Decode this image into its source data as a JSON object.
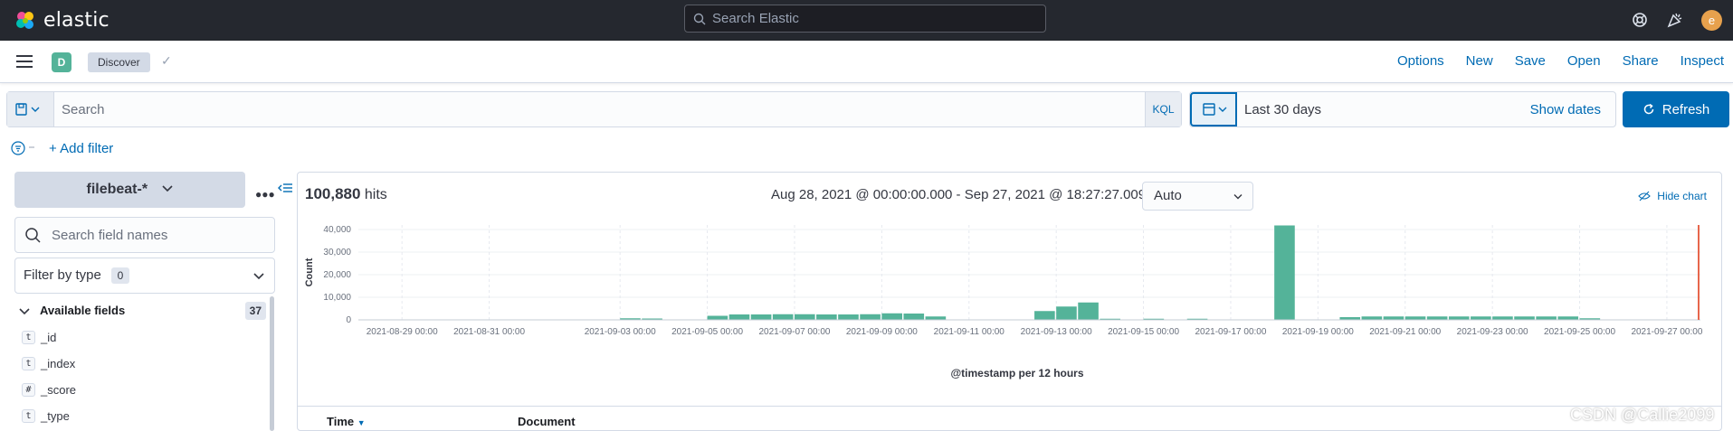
{
  "header": {
    "brand": "elastic",
    "search_placeholder": "Search Elastic",
    "avatar_initial": "e"
  },
  "appbar": {
    "space_initial": "D",
    "breadcrumb": "Discover",
    "links": [
      "Options",
      "New",
      "Save",
      "Open",
      "Share",
      "Inspect"
    ]
  },
  "query": {
    "placeholder": "Search",
    "language": "KQL",
    "time_range": "Last 30 days",
    "show_dates": "Show dates",
    "refresh": "Refresh",
    "add_filter": "+ Add filter"
  },
  "sidebar": {
    "index_pattern": "filebeat-*",
    "field_search_placeholder": "Search field names",
    "filter_by_type": "Filter by type",
    "filter_count": "0",
    "available_fields_label": "Available fields",
    "available_fields_count": "37",
    "fields": [
      {
        "type": "t",
        "name": "_id"
      },
      {
        "type": "t",
        "name": "_index"
      },
      {
        "type": "#",
        "name": "_score"
      },
      {
        "type": "t",
        "name": "_type"
      }
    ]
  },
  "main": {
    "hits_count": "100,880",
    "hits_label": "hits",
    "time_range_text": "Aug 28, 2021 @ 00:00:00.000 - Sep 27, 2021 @ 18:27:27.009",
    "interval": "Auto",
    "hide_chart": "Hide chart",
    "table_columns": [
      "Time",
      "Document"
    ]
  },
  "chart_data": {
    "type": "bar",
    "ylabel": "Count",
    "xlabel": "@timestamp per 12 hours",
    "ylim": [
      0,
      42000
    ],
    "y_ticks": [
      "0",
      "10,000",
      "20,000",
      "30,000",
      "40,000"
    ],
    "x_ticks": [
      "2021-08-29 00:00",
      "2021-08-31 00:00",
      "2021-09-03 00:00",
      "2021-09-05 00:00",
      "2021-09-07 00:00",
      "2021-09-09 00:00",
      "2021-09-11 00:00",
      "2021-09-13 00:00",
      "2021-09-15 00:00",
      "2021-09-17 00:00",
      "2021-09-19 00:00",
      "2021-09-21 00:00",
      "2021-09-23 00:00",
      "2021-09-25 00:00",
      "2021-09-27 00:00"
    ],
    "bar_color": "#54b399",
    "now_marker_color": "#e7664c",
    "series": [
      {
        "x": "2021-09-03 00:00",
        "y": 700
      },
      {
        "x": "2021-09-03 12:00",
        "y": 600
      },
      {
        "x": "2021-09-05 00:00",
        "y": 1800
      },
      {
        "x": "2021-09-05 12:00",
        "y": 2400
      },
      {
        "x": "2021-09-06 00:00",
        "y": 2400
      },
      {
        "x": "2021-09-06 12:00",
        "y": 2500
      },
      {
        "x": "2021-09-07 00:00",
        "y": 2500
      },
      {
        "x": "2021-09-07 12:00",
        "y": 2400
      },
      {
        "x": "2021-09-08 00:00",
        "y": 2400
      },
      {
        "x": "2021-09-08 12:00",
        "y": 2500
      },
      {
        "x": "2021-09-09 00:00",
        "y": 2900
      },
      {
        "x": "2021-09-09 12:00",
        "y": 2800
      },
      {
        "x": "2021-09-10 00:00",
        "y": 1500
      },
      {
        "x": "2021-09-12 12:00",
        "y": 3900
      },
      {
        "x": "2021-09-13 00:00",
        "y": 5900
      },
      {
        "x": "2021-09-13 12:00",
        "y": 7700
      },
      {
        "x": "2021-09-14 00:00",
        "y": 500
      },
      {
        "x": "2021-09-15 00:00",
        "y": 500
      },
      {
        "x": "2021-09-16 00:00",
        "y": 500
      },
      {
        "x": "2021-09-18 00:00",
        "y": 41800
      },
      {
        "x": "2021-09-19 12:00",
        "y": 1200
      },
      {
        "x": "2021-09-20 00:00",
        "y": 1500
      },
      {
        "x": "2021-09-20 12:00",
        "y": 1500
      },
      {
        "x": "2021-09-21 00:00",
        "y": 1500
      },
      {
        "x": "2021-09-21 12:00",
        "y": 1500
      },
      {
        "x": "2021-09-22 00:00",
        "y": 1500
      },
      {
        "x": "2021-09-22 12:00",
        "y": 1500
      },
      {
        "x": "2021-09-23 00:00",
        "y": 1500
      },
      {
        "x": "2021-09-23 12:00",
        "y": 1500
      },
      {
        "x": "2021-09-24 00:00",
        "y": 1500
      },
      {
        "x": "2021-09-24 12:00",
        "y": 1500
      },
      {
        "x": "2021-09-25 00:00",
        "y": 700
      }
    ]
  },
  "watermark": "CSDN @Callie2099"
}
